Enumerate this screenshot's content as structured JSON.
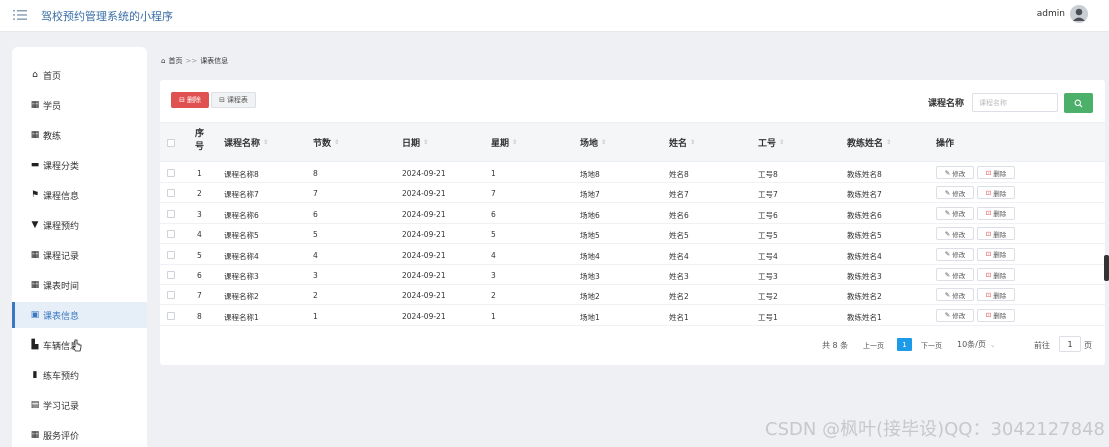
{
  "header": {
    "title": "驾校预约管理系统的小程序",
    "admin": "admin",
    "menu_icon": "menu-icon",
    "avatar_icon": "avatar"
  },
  "sidebar": {
    "items": [
      {
        "label": "首页",
        "icon": "home-icon"
      },
      {
        "label": "学员",
        "icon": "grid-icon"
      },
      {
        "label": "教练",
        "icon": "grid-icon"
      },
      {
        "label": "课程分类",
        "icon": "briefcase-icon"
      },
      {
        "label": "课程信息",
        "icon": "flag-icon"
      },
      {
        "label": "课程预约",
        "icon": "bookmark-icon"
      },
      {
        "label": "课程记录",
        "icon": "grid-icon"
      },
      {
        "label": "课表时间",
        "icon": "grid-icon"
      },
      {
        "label": "课表信息",
        "icon": "calendar-icon",
        "active": true
      },
      {
        "label": "车辆信息",
        "icon": "car-icon"
      },
      {
        "label": "练车预约",
        "icon": "chart-icon"
      },
      {
        "label": "学习记录",
        "icon": "book-icon"
      },
      {
        "label": "服务评价",
        "icon": "grid-icon"
      }
    ]
  },
  "breadcrumb": {
    "home": "首页",
    "sep": ">>",
    "current": "课表信息"
  },
  "toolbar": {
    "delete_label": "删除",
    "schedule_label": "课程表",
    "search_label": "课程名称",
    "search_placeholder": "课程名称"
  },
  "table": {
    "seq_header_line1": "序",
    "seq_header_line2": "号",
    "headers": {
      "course_name": "课程名称",
      "sessions": "节数",
      "date": "日期",
      "weekday": "星期",
      "venue": "场地",
      "name": "姓名",
      "job_no": "工号",
      "coach_name": "教练姓名",
      "ops": "操作"
    },
    "edit_label": "修改",
    "delete_label": "删除",
    "rows": [
      {
        "seq": "1",
        "course_name": "课程名称8",
        "sessions": "8",
        "date": "2024-09-21",
        "weekday": "1",
        "venue": "场地8",
        "name": "姓名8",
        "job_no": "工号8",
        "coach_name": "教练姓名8"
      },
      {
        "seq": "2",
        "course_name": "课程名称7",
        "sessions": "7",
        "date": "2024-09-21",
        "weekday": "7",
        "venue": "场地7",
        "name": "姓名7",
        "job_no": "工号7",
        "coach_name": "教练姓名7"
      },
      {
        "seq": "3",
        "course_name": "课程名称6",
        "sessions": "6",
        "date": "2024-09-21",
        "weekday": "6",
        "venue": "场地6",
        "name": "姓名6",
        "job_no": "工号6",
        "coach_name": "教练姓名6"
      },
      {
        "seq": "4",
        "course_name": "课程名称5",
        "sessions": "5",
        "date": "2024-09-21",
        "weekday": "5",
        "venue": "场地5",
        "name": "姓名5",
        "job_no": "工号5",
        "coach_name": "教练姓名5"
      },
      {
        "seq": "5",
        "course_name": "课程名称4",
        "sessions": "4",
        "date": "2024-09-21",
        "weekday": "4",
        "venue": "场地4",
        "name": "姓名4",
        "job_no": "工号4",
        "coach_name": "教练姓名4"
      },
      {
        "seq": "6",
        "course_name": "课程名称3",
        "sessions": "3",
        "date": "2024-09-21",
        "weekday": "3",
        "venue": "场地3",
        "name": "姓名3",
        "job_no": "工号3",
        "coach_name": "教练姓名3"
      },
      {
        "seq": "7",
        "course_name": "课程名称2",
        "sessions": "2",
        "date": "2024-09-21",
        "weekday": "2",
        "venue": "场地2",
        "name": "姓名2",
        "job_no": "工号2",
        "coach_name": "教练姓名2"
      },
      {
        "seq": "8",
        "course_name": "课程名称1",
        "sessions": "1",
        "date": "2024-09-21",
        "weekday": "1",
        "venue": "场地1",
        "name": "姓名1",
        "job_no": "工号1",
        "coach_name": "教练姓名1"
      }
    ]
  },
  "pagination": {
    "total": "共 8 条",
    "prev": "上一页",
    "current": "1",
    "next": "下一页",
    "page_size": "10条/页",
    "goto_label": "前往",
    "goto_value": "1",
    "page_unit": "页"
  },
  "watermark": "CSDN @枫叶(接毕设)QQ：3042127848",
  "colors": {
    "accent": "#3a78c2",
    "danger": "#e05252",
    "success": "#4caf6a",
    "page_active": "#1e9be8"
  }
}
